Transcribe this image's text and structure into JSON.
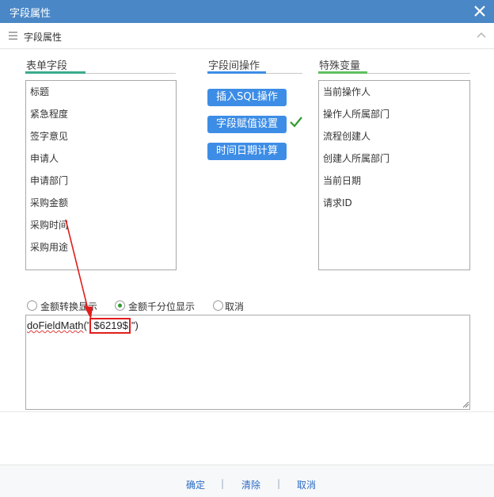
{
  "dialog": {
    "title": "字段属性"
  },
  "subheader": {
    "title": "字段属性"
  },
  "form_fields": {
    "heading": "表单字段",
    "accent": "#3aab8c",
    "items": [
      "标题",
      "紧急程度",
      "签字意见",
      "申请人",
      "申请部门",
      "采购金额",
      "采购时间",
      "采购用途"
    ]
  },
  "field_ops": {
    "heading": "字段间操作",
    "accent": "#3d8de6",
    "buttons": [
      "插入SQL操作",
      "字段赋值设置",
      "时间日期计算"
    ]
  },
  "special_vars": {
    "heading": "特殊变量",
    "accent": "#5fbf5f",
    "items": [
      "当前操作人",
      "操作人所属部门",
      "流程创建人",
      "创建人所属部门",
      "当前日期",
      "请求ID"
    ]
  },
  "display_options": {
    "options": [
      "金额转换显示",
      "金额千分位显示",
      "取消"
    ],
    "selected": "金额千分位显示"
  },
  "formula": {
    "prefix_fn": "doFieldMath",
    "prefix_rest": "(\"",
    "token": "$6219$",
    "suffix": "\")"
  },
  "footer": {
    "confirm": "确定",
    "clear": "清除",
    "cancel": "取消",
    "separator": "|"
  },
  "colors": {
    "titlebar": "#4a87c6",
    "button": "#3d8de6",
    "annotation": "#e21d1d",
    "check": "#2e9c2e"
  },
  "icons": [
    "close-icon",
    "menu-icon",
    "collapse-chevron-icon",
    "checkmark-icon",
    "resize-grip-icon"
  ]
}
